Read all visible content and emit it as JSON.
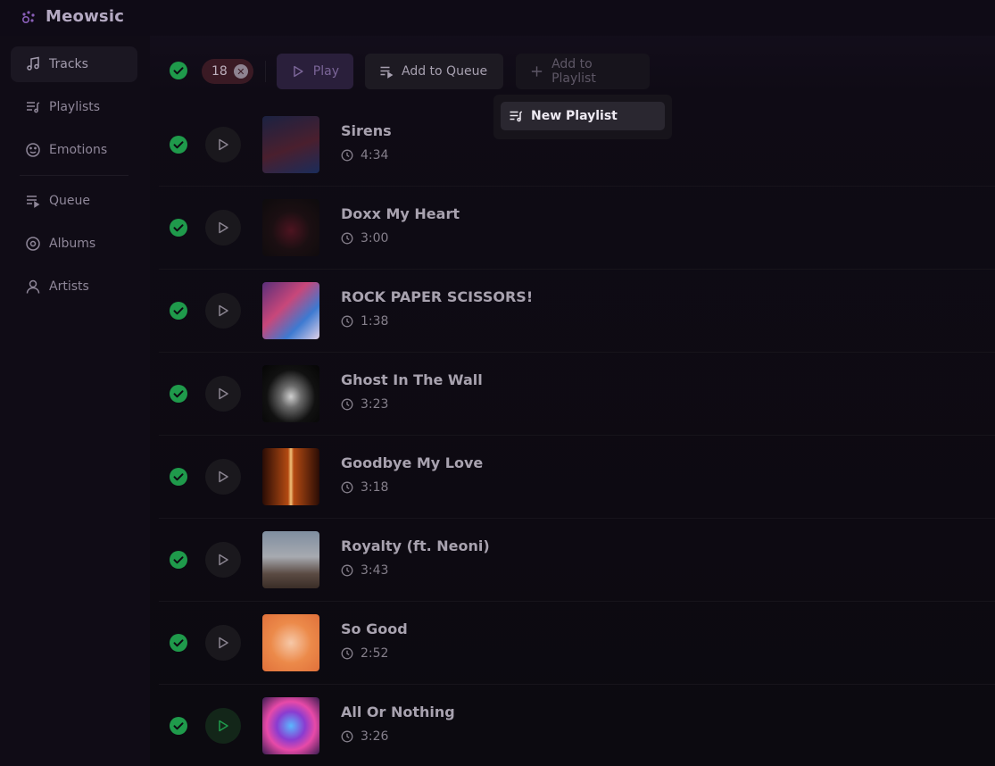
{
  "app": {
    "name": "Meowsic"
  },
  "sidebar": {
    "items": [
      {
        "label": "Tracks",
        "icon": "music-note-icon",
        "active": true
      },
      {
        "label": "Playlists",
        "icon": "playlist-icon"
      },
      {
        "label": "Emotions",
        "icon": "smiley-icon"
      },
      {
        "label": "Queue",
        "icon": "queue-icon"
      },
      {
        "label": "Albums",
        "icon": "disc-icon"
      },
      {
        "label": "Artists",
        "icon": "user-icon"
      }
    ]
  },
  "toolbar": {
    "selected_count": "18",
    "play_label": "Play",
    "queue_label": "Add to Queue",
    "add_playlist_label": "Add to Playlist"
  },
  "dropdown": {
    "new_playlist_label": "New Playlist"
  },
  "tracks": [
    {
      "title": "Sirens",
      "duration": "4:34"
    },
    {
      "title": "Doxx My Heart",
      "duration": "3:00"
    },
    {
      "title": "ROCK PAPER SCISSORS!",
      "duration": "1:38"
    },
    {
      "title": "Ghost In The Wall",
      "duration": "3:23"
    },
    {
      "title": "Goodbye My Love",
      "duration": "3:18"
    },
    {
      "title": "Royalty (ft. Neoni)",
      "duration": "3:43"
    },
    {
      "title": "So Good",
      "duration": "2:52"
    },
    {
      "title": "All Or Nothing",
      "duration": "3:26",
      "playing": true
    }
  ],
  "colors": {
    "accent_green": "#1f9a4b",
    "accent_purple": "#7b6598",
    "background": "#0c0a10"
  }
}
